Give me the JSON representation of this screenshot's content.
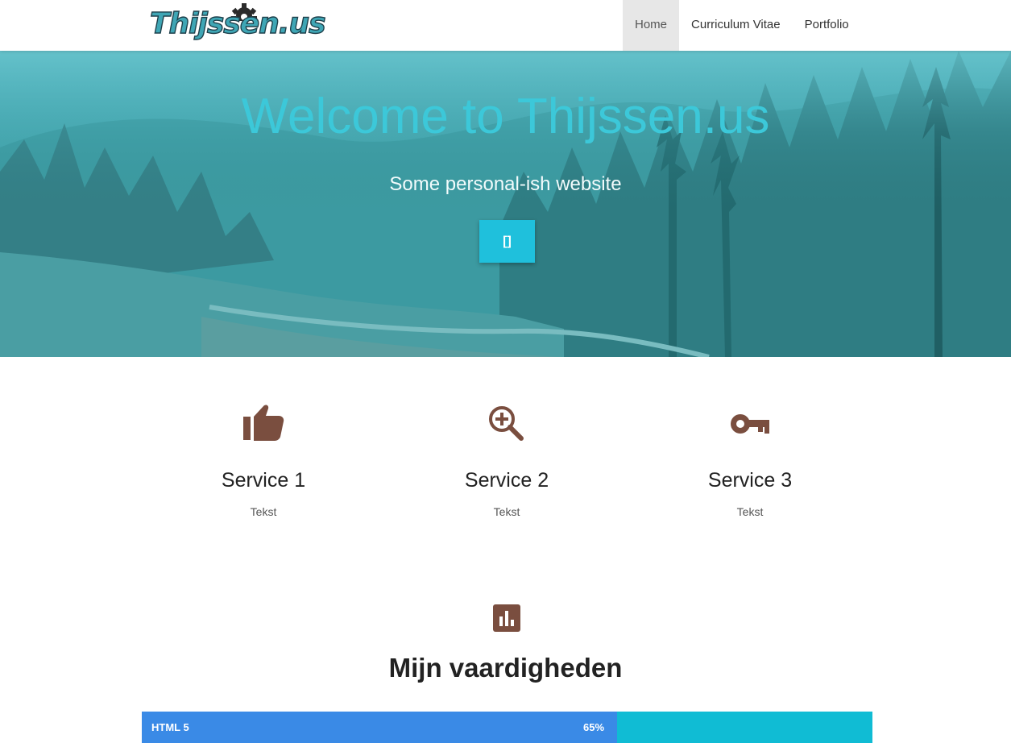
{
  "brand": {
    "logo_text": "Thijssen.us"
  },
  "nav": {
    "items": [
      {
        "label": "Home",
        "active": true
      },
      {
        "label": "Curriculum Vitae",
        "active": false
      },
      {
        "label": "Portfolio",
        "active": false
      }
    ]
  },
  "hero": {
    "title": "Welcome to Thijssen.us",
    "subtitle": "Some personal-ish website",
    "button_glyph": "[]"
  },
  "services": [
    {
      "icon": "thumbs-up-icon",
      "title": "Service 1",
      "text": "Tekst"
    },
    {
      "icon": "zoom-in-icon",
      "title": "Service 2",
      "text": "Tekst"
    },
    {
      "icon": "key-icon",
      "title": "Service 3",
      "text": "Tekst"
    }
  ],
  "skills": {
    "icon": "bar-chart-icon",
    "title": "Mijn vaardigheden",
    "items": [
      {
        "label": "HTML 5",
        "percent_text": "65%",
        "percent": 65
      }
    ]
  },
  "colors": {
    "hero_title": "#3cc8d9",
    "hero_button": "#1fc0dc",
    "icon_brown": "#7a4e3f",
    "progress_fill": "#3a8ae6",
    "progress_track": "#10bcd4",
    "nav_active_bg": "#e7e7e7"
  }
}
